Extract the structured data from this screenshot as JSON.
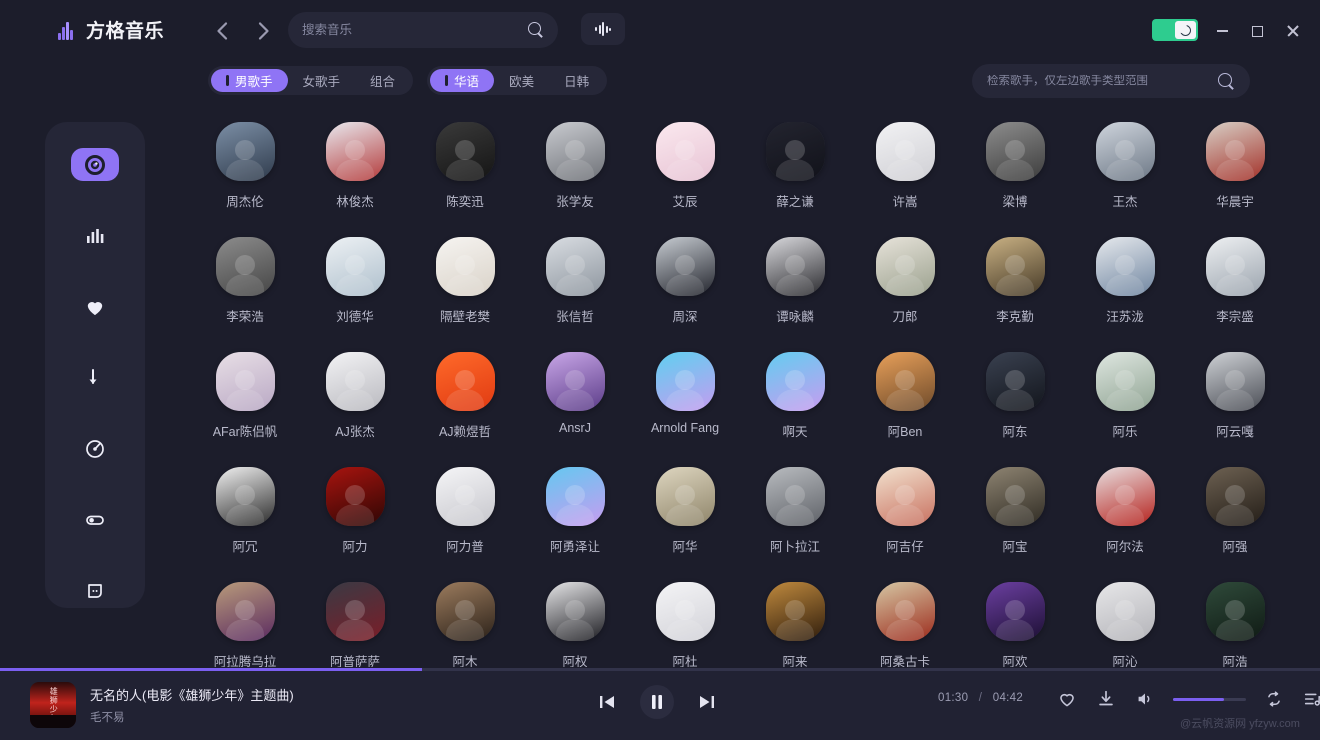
{
  "app": {
    "title": "方格音乐",
    "logo_icon": "sound-wave-icon"
  },
  "topbar": {
    "back_icon": "chevron-left-icon",
    "forward_icon": "chevron-right-icon",
    "search_placeholder": "搜索音乐",
    "search_value": "",
    "search_icon": "search-icon",
    "pulse_icon": "audio-pulse-icon",
    "theme_toggle_icon": "moon-icon",
    "theme_toggle_color": "#2ecc8f",
    "minimize_icon": "minimize-icon",
    "maximize_icon": "maximize-icon",
    "close_icon": "close-icon"
  },
  "filters": {
    "gender": [
      {
        "label": "男歌手",
        "active": true
      },
      {
        "label": "女歌手",
        "active": false
      },
      {
        "label": "组合",
        "active": false
      }
    ],
    "region": [
      {
        "label": "华语",
        "active": true
      },
      {
        "label": "欧美",
        "active": false
      },
      {
        "label": "日韩",
        "active": false
      }
    ],
    "artist_search_placeholder": "检索歌手，仅左边歌手类型范围",
    "artist_search_value": "",
    "artist_search_icon": "search-icon",
    "accent_color": "#8f74f5"
  },
  "sidebar": {
    "items": [
      {
        "icon": "disc-icon",
        "active": true
      },
      {
        "icon": "chart-bars-icon",
        "active": false
      },
      {
        "icon": "heart-icon",
        "active": false
      },
      {
        "icon": "download-arrow-icon",
        "active": false
      },
      {
        "icon": "compass-icon",
        "active": false
      },
      {
        "icon": "toggle-icon",
        "active": false
      },
      {
        "icon": "speech-bubble-icon",
        "active": false
      }
    ]
  },
  "artists": [
    {
      "name": "周杰伦",
      "c1": "#7c8fa6",
      "c2": "#2f3b4c"
    },
    {
      "name": "林俊杰",
      "c1": "#e9e9ef",
      "c2": "#b33a3a"
    },
    {
      "name": "陈奕迅",
      "c1": "#3a3a3a",
      "c2": "#141414"
    },
    {
      "name": "张学友",
      "c1": "#c9cbd0",
      "c2": "#6e7177"
    },
    {
      "name": "艾辰",
      "c1": "#fbe9ef",
      "c2": "#e7c3d4"
    },
    {
      "name": "薛之谦",
      "c1": "#23242f",
      "c2": "#11121a"
    },
    {
      "name": "许嵩",
      "c1": "#f2f2f4",
      "c2": "#cfcfd4"
    },
    {
      "name": "梁博",
      "c1": "#8d8d8d",
      "c2": "#3c3c3c"
    },
    {
      "name": "王杰",
      "c1": "#cfd5dd",
      "c2": "#6c7785"
    },
    {
      "name": "华晨宇",
      "c1": "#d8cfc6",
      "c2": "#a33028"
    },
    {
      "name": "李荣浩",
      "c1": "#8c8c8c",
      "c2": "#454545"
    },
    {
      "name": "刘德华",
      "c1": "#edf1f4",
      "c2": "#aebfcc"
    },
    {
      "name": "隔壁老樊",
      "c1": "#f6f4f1",
      "c2": "#d9d2c8"
    },
    {
      "name": "张信哲",
      "c1": "#d9dde2",
      "c2": "#8d959e"
    },
    {
      "name": "周深",
      "c1": "#c7ccd2",
      "c2": "#22242c"
    },
    {
      "name": "谭咏麟",
      "c1": "#d9d9dd",
      "c2": "#2a2a2e"
    },
    {
      "name": "刀郎",
      "c1": "#e7e3da",
      "c2": "#9aa08d"
    },
    {
      "name": "李克勤",
      "c1": "#c9b184",
      "c2": "#463a27"
    },
    {
      "name": "汪苏泷",
      "c1": "#e6e9ed",
      "c2": "#6f85a0"
    },
    {
      "name": "李宗盛",
      "c1": "#eef0f2",
      "c2": "#9aa3ad"
    },
    {
      "name": "AFar陈侣帆",
      "c1": "#e8dfe6",
      "c2": "#b9a8c4"
    },
    {
      "name": "AJ张杰",
      "c1": "#f3f3f5",
      "c2": "#b9b9bf"
    },
    {
      "name": "AJ赖煜哲",
      "c1": "#ff6a2a",
      "c2": "#e03a12"
    },
    {
      "name": "AnsrJ",
      "c1": "#c9a7e8",
      "c2": "#5b3c88"
    },
    {
      "name": "Arnold Fang",
      "c1": "#5fd0f0",
      "c2": "#c49cf0"
    },
    {
      "name": "啊天",
      "c1": "#63cdf0",
      "c2": "#c79cf0"
    },
    {
      "name": "阿Ben",
      "c1": "#e8a05a",
      "c2": "#6e4a2a"
    },
    {
      "name": "阿东",
      "c1": "#3a4150",
      "c2": "#12151c"
    },
    {
      "name": "阿乐",
      "c1": "#dfe7e1",
      "c2": "#8fa392"
    },
    {
      "name": "阿云嘎",
      "c1": "#cfd2d6",
      "c2": "#4a4d55"
    },
    {
      "name": "阿冗",
      "c1": "#f1f1f1",
      "c2": "#2a2a2a"
    },
    {
      "name": "阿力",
      "c1": "#a8140f",
      "c2": "#2d0604"
    },
    {
      "name": "阿力普",
      "c1": "#f5f5f7",
      "c2": "#c6c6cc"
    },
    {
      "name": "阿勇泽让",
      "c1": "#64c8f0",
      "c2": "#c79cf0"
    },
    {
      "name": "阿华",
      "c1": "#ded6c0",
      "c2": "#8e8469"
    },
    {
      "name": "阿卜拉江",
      "c1": "#b9bcc0",
      "c2": "#5e6167"
    },
    {
      "name": "阿吉仔",
      "c1": "#f2e2cf",
      "c2": "#c8705f"
    },
    {
      "name": "阿宝",
      "c1": "#8e8472",
      "c2": "#2f2b23"
    },
    {
      "name": "阿尔法",
      "c1": "#e8dfe0",
      "c2": "#b5211c"
    },
    {
      "name": "阿强",
      "c1": "#6d6152",
      "c2": "#231d17"
    },
    {
      "name": "阿拉腾乌拉",
      "c1": "#b99b7b",
      "c2": "#5a2a60"
    },
    {
      "name": "阿普萨萨",
      "c1": "#3a3a44",
      "c2": "#7b1d28"
    },
    {
      "name": "阿木",
      "c1": "#9c7c5e",
      "c2": "#2b2119"
    },
    {
      "name": "阿权",
      "c1": "#e6e6e8",
      "c2": "#1d1d22"
    },
    {
      "name": "阿杜",
      "c1": "#f4f4f6",
      "c2": "#d2d2d8"
    },
    {
      "name": "阿来",
      "c1": "#c08a3e",
      "c2": "#2e1c0c"
    },
    {
      "name": "阿桑古卡",
      "c1": "#d6c7a4",
      "c2": "#9c2b1c"
    },
    {
      "name": "阿欢",
      "c1": "#6b3fa0",
      "c2": "#1c0f33"
    },
    {
      "name": "阿沁",
      "c1": "#e7e7e9",
      "c2": "#b3b3b8"
    },
    {
      "name": "阿浩",
      "c1": "#2f4a3a",
      "c2": "#0f1a14"
    }
  ],
  "player": {
    "progress_percent": 32,
    "progress_color": "#7b5ff0",
    "cover_text": "雄狮少年",
    "track_title": "无名的人(电影《雄狮少年》主题曲)",
    "track_artist": "毛不易",
    "prev_icon": "skip-previous-icon",
    "play_icon": "pause-icon",
    "next_icon": "skip-next-icon",
    "current_time": "01:30",
    "separator": "/",
    "total_time": "04:42",
    "like_icon": "heart-icon",
    "download_icon": "download-icon",
    "volume_icon": "volume-icon",
    "volume_percent": 70,
    "repeat_icon": "repeat-icon",
    "playlist_icon": "playlist-icon"
  },
  "watermark": "@云帆资源网 yfzyw.com"
}
